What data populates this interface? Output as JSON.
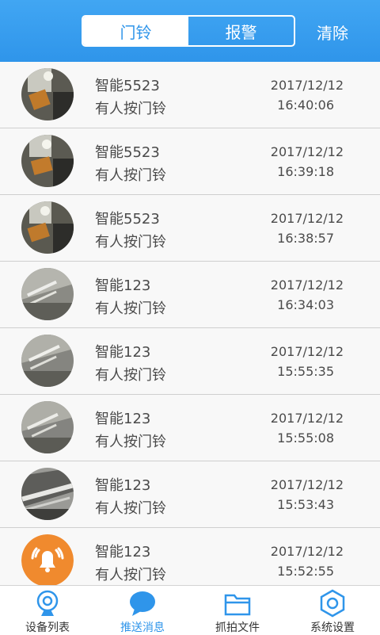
{
  "header": {
    "tabs": [
      {
        "label": "门铃",
        "active": true
      },
      {
        "label": "报警",
        "active": false
      }
    ],
    "clear_label": "清除"
  },
  "messages": [
    {
      "name": "智能5523",
      "message": "有人按门铃",
      "date": "2017/12/12",
      "time": "16:40:06",
      "thumb": "photo"
    },
    {
      "name": "智能5523",
      "message": "有人按门铃",
      "date": "2017/12/12",
      "time": "16:39:18",
      "thumb": "photo"
    },
    {
      "name": "智能5523",
      "message": "有人按门铃",
      "date": "2017/12/12",
      "time": "16:38:57",
      "thumb": "photo"
    },
    {
      "name": "智能123",
      "message": "有人按门铃",
      "date": "2017/12/12",
      "time": "16:34:03",
      "thumb": "photo"
    },
    {
      "name": "智能123",
      "message": "有人按门铃",
      "date": "2017/12/12",
      "time": "15:55:35",
      "thumb": "photo"
    },
    {
      "name": "智能123",
      "message": "有人按门铃",
      "date": "2017/12/12",
      "time": "15:55:08",
      "thumb": "photo"
    },
    {
      "name": "智能123",
      "message": "有人按门铃",
      "date": "2017/12/12",
      "time": "15:53:43",
      "thumb": "photo"
    },
    {
      "name": "智能123",
      "message": "有人按门铃",
      "date": "2017/12/12",
      "time": "15:52:55",
      "thumb": "bell-icon"
    }
  ],
  "bottom_nav": [
    {
      "label": "设备列表",
      "icon": "camera-icon",
      "active": false
    },
    {
      "label": "推送消息",
      "icon": "chat-bubble-icon",
      "active": true
    },
    {
      "label": "抓拍文件",
      "icon": "folder-icon",
      "active": false
    },
    {
      "label": "系统设置",
      "icon": "gear-icon",
      "active": false
    }
  ],
  "colors": {
    "accent": "#2f95ea",
    "bell_badge": "#f08a2e"
  }
}
